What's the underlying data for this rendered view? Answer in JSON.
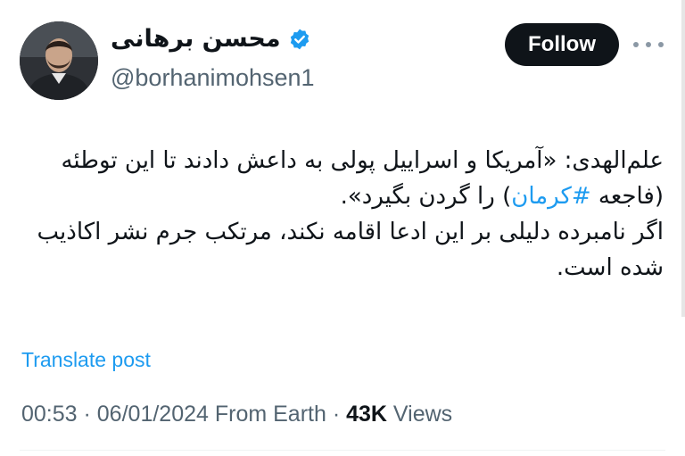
{
  "author": {
    "display_name": "محسن برهانی",
    "handle": "@borhanimohsen1",
    "verified": true,
    "verified_color": "#1d9bf0"
  },
  "actions": {
    "follow_label": "Follow",
    "more_icon": "more-horizontal-icon"
  },
  "tweet": {
    "text_before_hashtag": "علم‌الهدی: «آمریکا و اسراییل پولی به داعش دادند تا این توطئه (فاجعه ",
    "hashtag": "#کرمان",
    "text_after_hashtag": ") را گردن بگیرد».",
    "paragraph_2": "اگر نامبرده دلیلی بر این ادعا اقامه نکند، مرتکب جرم نشر اکاذیب شده است."
  },
  "translate_label": "Translate post",
  "meta": {
    "time": "00:53",
    "separator": " · ",
    "date": "06/01/2024",
    "source": " From Earth",
    "separator2": " · ",
    "views_count": "43K",
    "views_label": " Views"
  },
  "colors": {
    "link": "#1d9bf0",
    "secondary_text": "#536471",
    "primary_text": "#0f1419",
    "button_bg": "#0f1419"
  }
}
